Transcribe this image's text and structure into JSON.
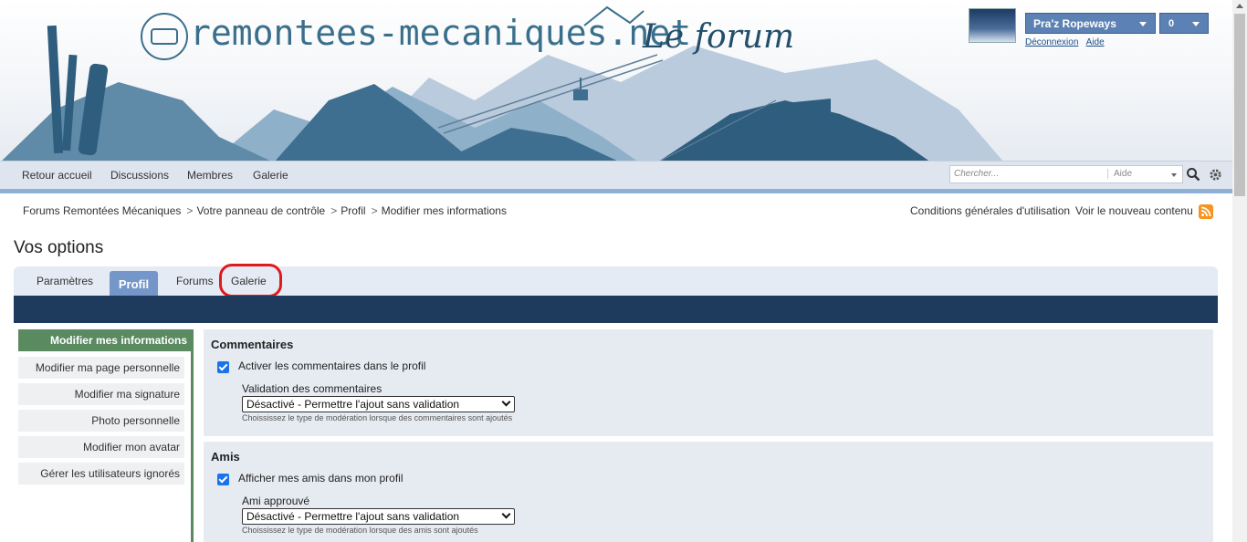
{
  "header": {
    "logo_text": "remontees-mecaniques.net",
    "logo_tagline": "Le forum"
  },
  "user": {
    "name": "Pra'z Ropeways",
    "notifications": "0",
    "logout": "Déconnexion",
    "help": "Aide"
  },
  "nav": {
    "items": [
      "Retour accueil",
      "Discussions",
      "Membres",
      "Galerie"
    ]
  },
  "search": {
    "placeholder": "Chercher...",
    "scope": "Aide"
  },
  "breadcrumb": [
    "Forums Remontées Mécaniques",
    "Votre panneau de contrôle",
    "Profil",
    "Modifier mes informations"
  ],
  "top_links": {
    "terms": "Conditions générales d'utilisation",
    "new_content": "Voir le nouveau contenu"
  },
  "page_title": "Vos options",
  "tabs": [
    "Paramètres",
    "Profil",
    "Forums",
    "Galerie"
  ],
  "active_tab": "Profil",
  "sidebar": {
    "header": "Modifier mes informations",
    "items": [
      "Modifier ma page personnelle",
      "Modifier ma signature",
      "Photo personnelle",
      "Modifier mon avatar",
      "Gérer les utilisateurs ignorés"
    ]
  },
  "sections": {
    "comments": {
      "title": "Commentaires",
      "checkbox_label": "Activer les commentaires dans le profil",
      "field_label": "Validation des commentaires",
      "select_value": "Désactivé - Permettre l'ajout sans validation",
      "hint": "Choississez le type de modération lorsque des commentaires sont ajoutés"
    },
    "friends": {
      "title": "Amis",
      "checkbox_label": "Afficher mes amis dans mon profil",
      "field_label": "Ami approuvé",
      "select_value": "Désactivé - Permettre l'ajout sans validation",
      "hint": "Choississez le type de modération lorsque des amis sont ajoutés"
    }
  },
  "colors": {
    "highlight_circle": "#e0191d",
    "active_tab": "#7596c8",
    "sidebar_accent": "#5a8a60",
    "dark_bar": "#1e3a5c"
  }
}
